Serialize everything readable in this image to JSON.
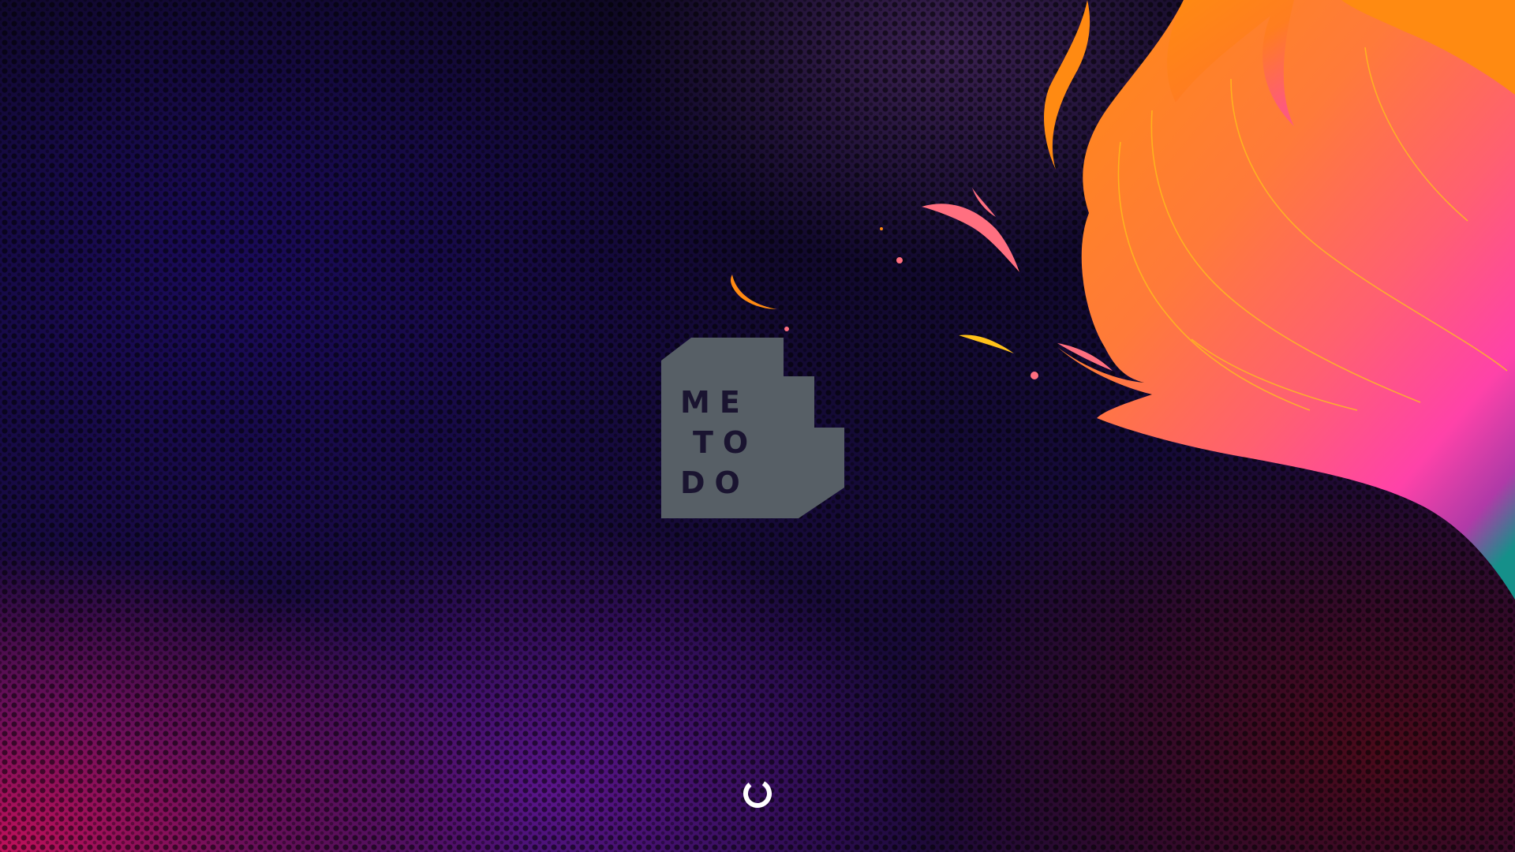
{
  "logo": {
    "lines": [
      "ME",
      "TO",
      "DO"
    ],
    "fill_color": "#575f66",
    "text_color": "#1a1430"
  },
  "loader": {
    "icon": "loading-spinner-icon",
    "color": "#ffffff"
  },
  "colors": {
    "flame_orange": "#ff8a12",
    "flame_pink": "#ff5f8a",
    "flame_magenta": "#ff3fb0",
    "flame_teal": "#1a8a8a",
    "spark_yellow": "#ffc21a"
  }
}
